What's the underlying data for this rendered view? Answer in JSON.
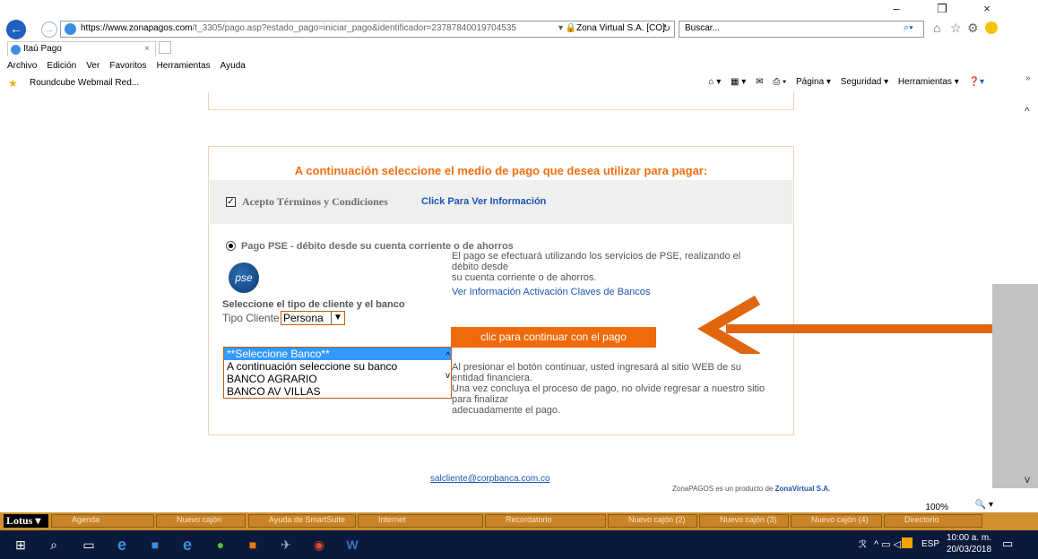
{
  "browser": {
    "window_buttons": [
      "–",
      "❐",
      "×"
    ],
    "url_host": "https://www.zonapagos.com",
    "url_path": "/t_3305/pago.asp?estado_pago=iniciar_pago&identificador=23787840019704535",
    "site_identity": "Zona Virtual S.A. [CO]",
    "search_placeholder": "Buscar...",
    "tab_title": "Itaú Pago",
    "menu": [
      "Archivo",
      "Edición",
      "Ver",
      "Favoritos",
      "Herramientas",
      "Ayuda"
    ],
    "favorite": "Roundcube Webmail Red...",
    "tools": [
      "Página ▾",
      "Seguridad ▾",
      "Herramientas ▾"
    ],
    "zoom": "100%"
  },
  "payment": {
    "title": "A continuación seleccione el medio de pago que desea utilizar para pagar:",
    "terms_label": "Acepto Términos y Condiciones",
    "terms_checked": true,
    "terms_link": "Click Para Ver Información",
    "option_label": "Pago PSE - débito desde su cuenta corriente o de ahorros",
    "logo_text": "pse",
    "description_lines": [
      "El pago se efectuará utilizando los servicios de PSE, realizando el",
      "débito desde",
      "su cuenta corriente o de ahorros."
    ],
    "bank_codes_link": "Ver Información Activación Claves de Bancos",
    "select_label": "Seleccione el tipo de cliente y el banco",
    "client_type_label": "Tipo Cliente",
    "client_type_value": "Persona",
    "continue_button": "clic para continuar con el pago",
    "banks": [
      "**Seleccione Banco**",
      "A continuación seleccione su banco",
      "BANCO AGRARIO",
      "BANCO AV VILLAS"
    ],
    "notice_lines": [
      "Al presionar el botón continuar, usted ingresará al sitio WEB de su",
      "entidad financiera.",
      "Una vez concluya el proceso de pago, no olvide regresar a nuestro sitio",
      "para finalizar",
      "adecuadamente el pago."
    ]
  },
  "footer": {
    "email": "salcliente@corpbanca.com.co",
    "product_prefix": "ZonaPAGOS es un producto de ",
    "product_company": "ZonaVirtual S.A."
  },
  "lotus": {
    "brand": "Lotus",
    "segments": [
      "Agenda",
      "Nuevo cajón",
      "Ayuda de SmartSuite",
      "Internet",
      "Recordatorio",
      "Nuevo cajón (2)",
      "Nuevo cajón (3)",
      "Nuevo cajón (4)",
      "Directorio"
    ]
  },
  "taskbar": {
    "language": "ESP",
    "time": "10:00 a. m.",
    "date": "20/03/2018"
  },
  "colors": {
    "accent_orange": "#ef6a0b",
    "title_orange": "#f36f0f",
    "link_blue": "#1b55b3",
    "annotation_arrow": "#e0660e"
  }
}
